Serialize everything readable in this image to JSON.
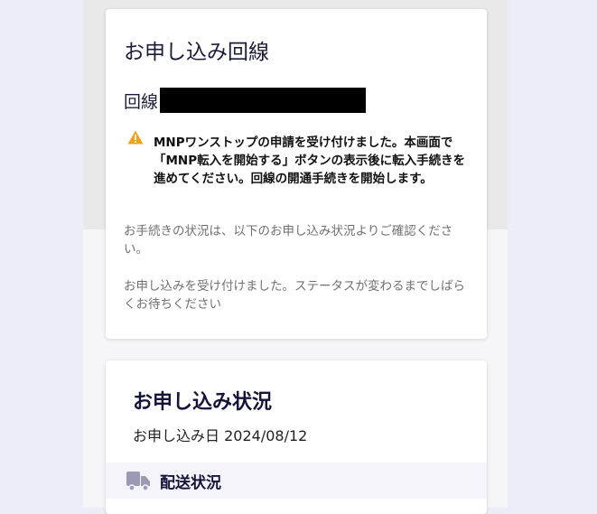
{
  "application_card": {
    "title": "お申し込み回線",
    "line_label": "回線",
    "warning_message": "MNPワンストップの申請を受け付けました。本画面で「MNP転入を開始する」ボタンの表示後に転入手続きを進めてください。回線の開通手続きを開始します。",
    "info_status": "お手続きの状況は、以下のお申し込み状況よりご確認ください。",
    "info_accepted": "お申し込みを受け付けました。ステータスが変わるまでしばらくお待ちください"
  },
  "status_card": {
    "title": "お申し込み状況",
    "date_label": "お申し込み日",
    "date_value": "2024/08/12",
    "delivery_label": "配送状況"
  },
  "icons": {
    "warning": "warning-triangle-icon",
    "delivery": "truck-icon"
  },
  "colors": {
    "warning": "#f0a21b",
    "icon_gray": "#9a9ab5",
    "title_navy": "#14143a",
    "page_bg": "#ebeef8"
  }
}
